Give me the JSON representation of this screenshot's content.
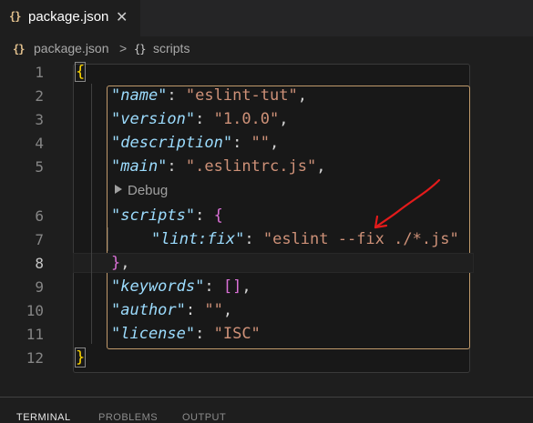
{
  "tab": {
    "icon": "{}",
    "label": "package.json",
    "close": "✕"
  },
  "breadcrumb": {
    "file_icon": "{}",
    "file": "package.json",
    "separator": ">",
    "node_icon": "{}",
    "node": "scripts"
  },
  "line_numbers": [
    "1",
    "2",
    "3",
    "4",
    "5",
    "6",
    "7",
    "8",
    "9",
    "10",
    "11",
    "12"
  ],
  "codelens": {
    "label": "Debug"
  },
  "code": {
    "l1_brace": "{",
    "l2_key": "\"name\"",
    "l2_sep": ": ",
    "l2_val": "\"eslint-tut\"",
    "l2_end": ",",
    "l3_key": "\"version\"",
    "l3_sep": ": ",
    "l3_val": "\"1.0.0\"",
    "l3_end": ",",
    "l4_key": "\"description\"",
    "l4_sep": ": ",
    "l4_val": "\"\"",
    "l4_end": ",",
    "l5_key": "\"main\"",
    "l5_sep": ": ",
    "l5_val": "\".eslintrc.js\"",
    "l5_end": ",",
    "l6_key": "\"scripts\"",
    "l6_sep": ": ",
    "l6_brace": "{",
    "l7_key": "\"lint:fix\"",
    "l7_sep": ": ",
    "l7_val": "\"eslint --fix ./*.js\"",
    "l8_brace": "}",
    "l8_end": ",",
    "l9_key": "\"keywords\"",
    "l9_sep": ": ",
    "l9_val": "[]",
    "l9_end": ",",
    "l10_key": "\"author\"",
    "l10_sep": ": ",
    "l10_val": "\"\"",
    "l10_end": ",",
    "l11_key": "\"license\"",
    "l11_sep": ": ",
    "l11_val": "\"ISC\"",
    "l12_brace": "}"
  },
  "panel": {
    "tabs": [
      "TERMINAL",
      "PROBLEMS",
      "OUTPUT"
    ]
  },
  "colors": {
    "key": "#9cdcfe",
    "string": "#ce9178",
    "brace": "#ffd700",
    "annotation": "#e31b1b"
  }
}
